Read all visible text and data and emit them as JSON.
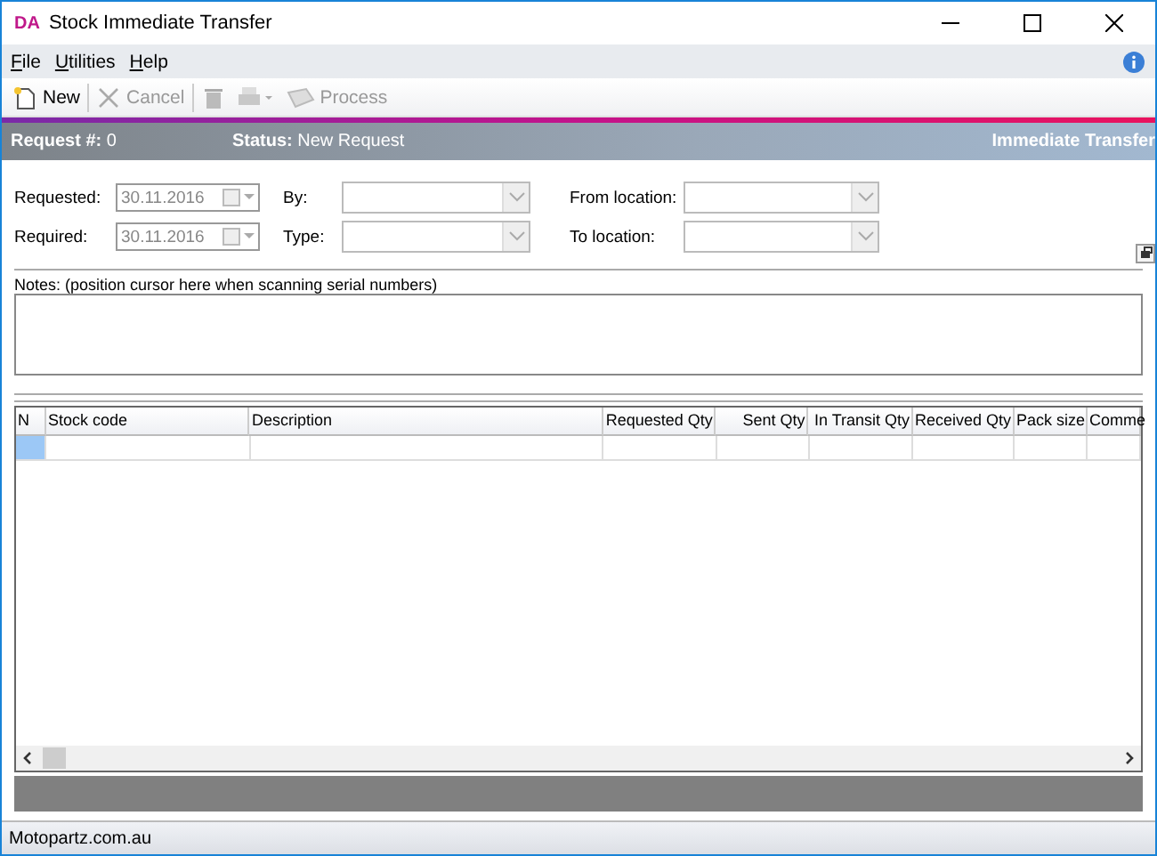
{
  "window": {
    "title": "Stock Immediate Transfer",
    "logo": "DA"
  },
  "menu": [
    "File",
    "Utilities",
    "Help"
  ],
  "toolbar": [
    {
      "kind": "new",
      "label": "New",
      "disabled": false
    },
    {
      "kind": "cancel",
      "label": "Cancel",
      "disabled": true
    },
    {
      "kind": "delete",
      "disabled": true
    },
    {
      "kind": "print",
      "disabled": true
    },
    {
      "kind": "process",
      "label": "Process",
      "disabled": true
    }
  ],
  "header": {
    "request_label": "Request #:",
    "request_value": "0",
    "status_label": "Status:",
    "status_value": "New Request",
    "mode": "Immediate Transfer"
  },
  "form": [
    [
      {
        "kind": "date",
        "label": "Requested:",
        "value": "30.11.2016",
        "disabled": true
      },
      {
        "kind": "combo",
        "label": "By:"
      },
      {
        "kind": "combo",
        "label": "From location:"
      }
    ],
    [
      {
        "kind": "date",
        "label": "Required:",
        "value": "30.11.2016",
        "disabled": true
      },
      {
        "kind": "combo",
        "label": "Type:"
      },
      {
        "kind": "combo",
        "label": "To location:"
      }
    ]
  ],
  "notes": {
    "label": "Notes:  (position cursor here when scanning serial numbers)"
  },
  "grid": {
    "columns": [
      {
        "label": "N"
      },
      {
        "label": "Stock code"
      },
      {
        "label": "Description"
      },
      {
        "label": "Requested Qty"
      },
      {
        "label": "Sent Qty"
      },
      {
        "label": "In Transit Qty"
      },
      {
        "label": "Received Qty"
      },
      {
        "label": "Pack size"
      },
      {
        "label": "Comme"
      }
    ],
    "rows": [
      {
        "selected": true
      }
    ]
  },
  "status_bar": {
    "text": "Motopartz.com.au"
  }
}
